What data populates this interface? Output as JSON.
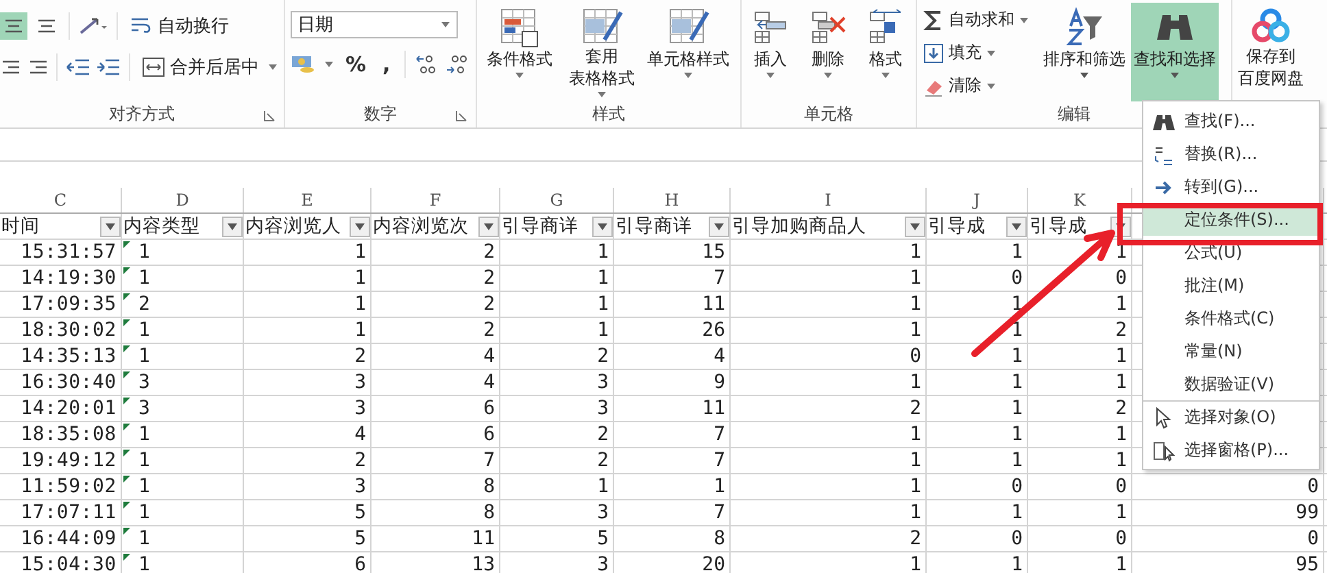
{
  "ribbon": {
    "alignment": {
      "label": "对齐方式",
      "align_buttons": [
        {
          "selected": true
        },
        {
          "selected": false
        },
        {
          "selected": false
        },
        {
          "selected": false
        }
      ],
      "wrap_text": "自动换行",
      "merge_center": "合并后居中"
    },
    "number": {
      "label": "数字",
      "format": "日期",
      "percent": "%",
      "comma": ","
    },
    "styles": {
      "label": "样式",
      "buttons": [
        {
          "lines": [
            "条件格式"
          ]
        },
        {
          "lines": [
            "套用",
            "表格格式"
          ]
        },
        {
          "lines": [
            "单元格样式"
          ]
        }
      ]
    },
    "cells": {
      "label": "单元格",
      "buttons": [
        {
          "label": "插入"
        },
        {
          "label": "删除"
        },
        {
          "label": "格式"
        }
      ]
    },
    "editing": {
      "label": "编辑",
      "small_buttons": [
        {
          "label": "自动求和"
        },
        {
          "label": "填充"
        },
        {
          "label": "清除"
        }
      ],
      "big_buttons": [
        {
          "label": "排序和筛选",
          "selected": false
        },
        {
          "label": "查找和选择",
          "selected": true
        }
      ]
    },
    "cloud": {
      "lines": [
        "保存到",
        "百度网盘"
      ]
    }
  },
  "sheet": {
    "columns": [
      {
        "letter": "C",
        "heading": "时间",
        "kind": "time"
      },
      {
        "letter": "D",
        "heading": "内容类型",
        "kind": "text",
        "error_marks": true
      },
      {
        "letter": "E",
        "heading": "内容浏览人",
        "kind": "number"
      },
      {
        "letter": "F",
        "heading": "内容浏览次",
        "kind": "number"
      },
      {
        "letter": "G",
        "heading": "引导商详",
        "kind": "number"
      },
      {
        "letter": "H",
        "heading": "引导商详",
        "kind": "number"
      },
      {
        "letter": "I",
        "heading": "引导加购商品人",
        "kind": "number"
      },
      {
        "letter": "J",
        "heading": "引导成",
        "kind": "number"
      },
      {
        "letter": "K",
        "heading": "引导成",
        "kind": "number"
      },
      {
        "kind": "number"
      }
    ],
    "rows": [
      {
        "cells": [
          "15:31:57",
          "1",
          "1",
          "2",
          "1",
          "15",
          "1",
          "1",
          "1"
        ]
      },
      {
        "cells": [
          "14:19:30",
          "1",
          "1",
          "2",
          "1",
          "7",
          "1",
          "0",
          "0"
        ]
      },
      {
        "cells": [
          "17:09:35",
          "2",
          "1",
          "2",
          "1",
          "11",
          "1",
          "1",
          "1"
        ]
      },
      {
        "cells": [
          "18:30:02",
          "1",
          "1",
          "2",
          "1",
          "26",
          "1",
          "1",
          "2"
        ]
      },
      {
        "cells": [
          "14:35:13",
          "1",
          "2",
          "4",
          "2",
          "4",
          "0",
          "1",
          "1"
        ]
      },
      {
        "cells": [
          "16:30:40",
          "3",
          "3",
          "4",
          "3",
          "9",
          "1",
          "1",
          "1"
        ]
      },
      {
        "cells": [
          "14:20:01",
          "3",
          "3",
          "6",
          "3",
          "11",
          "2",
          "1",
          "2"
        ]
      },
      {
        "cells": [
          "18:35:08",
          "1",
          "4",
          "6",
          "2",
          "7",
          "1",
          "1",
          "1"
        ]
      },
      {
        "cells": [
          "19:49:12",
          "1",
          "2",
          "7",
          "2",
          "7",
          "1",
          "1",
          "1"
        ]
      },
      {
        "cells": [
          "11:59:02",
          "1",
          "3",
          "8",
          "1",
          "1",
          "1",
          "0",
          "0",
          "0"
        ]
      },
      {
        "cells": [
          "17:07:11",
          "1",
          "5",
          "8",
          "3",
          "7",
          "1",
          "1",
          "1",
          "99"
        ]
      },
      {
        "cells": [
          "16:44:09",
          "1",
          "5",
          "11",
          "5",
          "8",
          "2",
          "0",
          "0",
          "0"
        ]
      },
      {
        "cells": [
          "15:04:30",
          "1",
          "6",
          "13",
          "3",
          "20",
          "1",
          "1",
          "1",
          "95"
        ]
      }
    ]
  },
  "menu": {
    "items": [
      {
        "label": "查找(F)...",
        "selected": false,
        "divider_above": false
      },
      {
        "label": "替换(R)...",
        "selected": false,
        "divider_above": false
      },
      {
        "label": "转到(G)...",
        "selected": false,
        "divider_above": false
      },
      {
        "label": "定位条件(S)...",
        "selected": true,
        "divider_above": false
      },
      {
        "label": "公式(U)",
        "selected": false,
        "divider_above": false
      },
      {
        "label": "批注(M)",
        "selected": false,
        "divider_above": false
      },
      {
        "label": "条件格式(C)",
        "selected": false,
        "divider_above": false
      },
      {
        "label": "常量(N)",
        "selected": false,
        "divider_above": false
      },
      {
        "label": "数据验证(V)",
        "selected": false,
        "divider_above": false
      },
      {
        "label": "选择对象(O)",
        "selected": false,
        "divider_above": true
      },
      {
        "label": "选择窗格(P)...",
        "selected": false,
        "divider_above": false
      }
    ]
  }
}
